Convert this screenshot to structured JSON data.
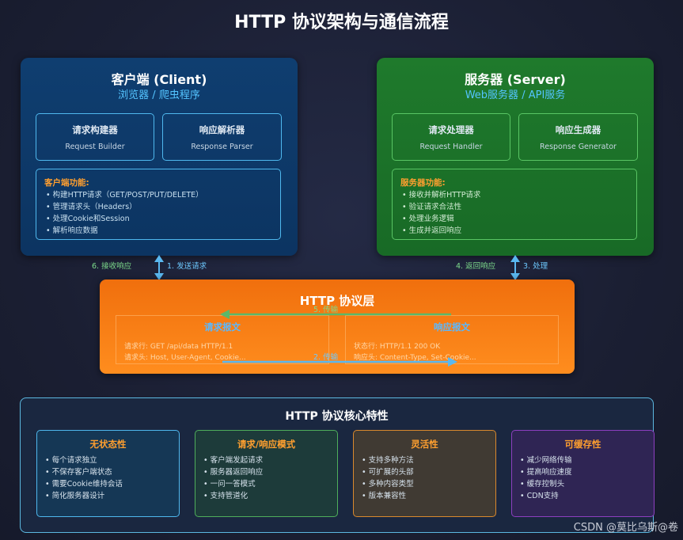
{
  "title": "HTTP 协议架构与通信流程",
  "client": {
    "title": "客户端 (Client)",
    "subtitle": "浏览器 / 爬虫程序",
    "box1": {
      "title": "请求构建器",
      "sub": "Request Builder"
    },
    "box2": {
      "title": "响应解析器",
      "sub": "Response Parser"
    },
    "functions_title": "客户端功能:",
    "functions": [
      "• 构建HTTP请求（GET/POST/PUT/DELETE）",
      "• 管理请求头（Headers）",
      "• 处理Cookie和Session",
      "• 解析响应数据"
    ]
  },
  "server": {
    "title": "服务器 (Server)",
    "subtitle": "Web服务器 / API服务",
    "box1": {
      "title": "请求处理器",
      "sub": "Request Handler"
    },
    "box2": {
      "title": "响应生成器",
      "sub": "Response Generator"
    },
    "functions_title": "服务器功能:",
    "functions": [
      "• 接收并解析HTTP请求",
      "• 验证请求合法性",
      "• 处理业务逻辑",
      "• 生成并返回响应"
    ]
  },
  "flows": {
    "receive": "6. 接收响应",
    "send": "1. 发送请求",
    "return": "4. 返回响应",
    "process": "3. 处理",
    "transfer_back": "5. 传输",
    "transfer": "2. 传输"
  },
  "protocol": {
    "title": "HTTP 协议层",
    "request": {
      "title": "请求报文",
      "line1": "请求行: GET /api/data HTTP/1.1",
      "line2": "请求头: Host, User-Agent, Cookie..."
    },
    "response": {
      "title": "响应报文",
      "line1": "状态行: HTTP/1.1 200 OK",
      "line2": "响应头: Content-Type, Set-Cookie..."
    }
  },
  "features": {
    "title": "HTTP 协议核心特性",
    "cards": [
      {
        "title": "无状态性",
        "items": [
          "• 每个请求独立",
          "• 不保存客户端状态",
          "• 需要Cookie维持会话",
          "• 简化服务器设计"
        ]
      },
      {
        "title": "请求/响应模式",
        "items": [
          "• 客户端发起请求",
          "• 服务器返回响应",
          "• 一问一答模式",
          "• 支持管道化"
        ]
      },
      {
        "title": "灵活性",
        "items": [
          "• 支持多种方法",
          "• 可扩展的头部",
          "• 多种内容类型",
          "• 版本兼容性"
        ]
      },
      {
        "title": "可缓存性",
        "items": [
          "• 减少网络传输",
          "• 提高响应速度",
          "• 缓存控制头",
          "• CDN支持"
        ]
      }
    ]
  },
  "watermark": "CSDN @莫比乌斯@卷",
  "colors": {
    "client_bg": "#0f3e70",
    "server_bg": "#1f7a2c",
    "protocol_bg": "#f6780f",
    "accent_orange": "#ff9f2f",
    "accent_blue": "#4fb8ee",
    "feature_card_bgs": [
      "#153755",
      "#1d3b3a",
      "#403a33",
      "#2f2554"
    ],
    "feature_card_borders": [
      "#4fb8ee",
      "#4fae5b",
      "#d9892e",
      "#8d3fc0"
    ]
  }
}
